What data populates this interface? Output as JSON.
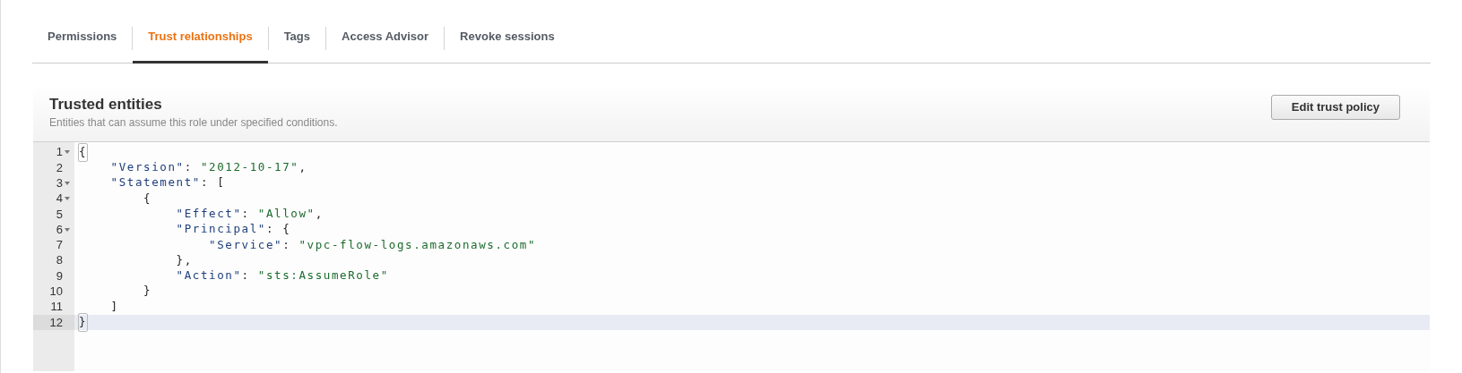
{
  "tabs": [
    {
      "label": "Permissions",
      "selected": false
    },
    {
      "label": "Trust relationships",
      "selected": true
    },
    {
      "label": "Tags",
      "selected": false
    },
    {
      "label": "Access Advisor",
      "selected": false
    },
    {
      "label": "Revoke sessions",
      "selected": false
    }
  ],
  "panel": {
    "title": "Trusted entities",
    "description": "Entities that can assume this role under specified conditions.",
    "button": "Edit trust policy"
  },
  "editor": {
    "lines": [
      {
        "number": "1",
        "foldable": true,
        "active": false,
        "tokens": [
          {
            "kind": "punct",
            "text": "{"
          }
        ]
      },
      {
        "number": "2",
        "foldable": false,
        "active": false,
        "tokens": [
          {
            "kind": "key",
            "text": "    \"Version\""
          },
          {
            "kind": "punct",
            "text": ": "
          },
          {
            "kind": "string",
            "text": "\"2012-10-17\""
          },
          {
            "kind": "punct",
            "text": ","
          }
        ]
      },
      {
        "number": "3",
        "foldable": true,
        "active": false,
        "tokens": [
          {
            "kind": "key",
            "text": "    \"Statement\""
          },
          {
            "kind": "punct",
            "text": ": ["
          }
        ]
      },
      {
        "number": "4",
        "foldable": true,
        "active": false,
        "tokens": [
          {
            "kind": "punct",
            "text": "        {"
          }
        ]
      },
      {
        "number": "5",
        "foldable": false,
        "active": false,
        "tokens": [
          {
            "kind": "key",
            "text": "            \"Effect\""
          },
          {
            "kind": "punct",
            "text": ": "
          },
          {
            "kind": "string",
            "text": "\"Allow\""
          },
          {
            "kind": "punct",
            "text": ","
          }
        ]
      },
      {
        "number": "6",
        "foldable": true,
        "active": false,
        "tokens": [
          {
            "kind": "key",
            "text": "            \"Principal\""
          },
          {
            "kind": "punct",
            "text": ": {"
          }
        ]
      },
      {
        "number": "7",
        "foldable": false,
        "active": false,
        "tokens": [
          {
            "kind": "key",
            "text": "                \"Service\""
          },
          {
            "kind": "punct",
            "text": ": "
          },
          {
            "kind": "string",
            "text": "\"vpc-flow-logs.amazonaws.com\""
          }
        ]
      },
      {
        "number": "8",
        "foldable": false,
        "active": false,
        "tokens": [
          {
            "kind": "punct",
            "text": "            },"
          }
        ]
      },
      {
        "number": "9",
        "foldable": false,
        "active": false,
        "tokens": [
          {
            "kind": "key",
            "text": "            \"Action\""
          },
          {
            "kind": "punct",
            "text": ": "
          },
          {
            "kind": "string",
            "text": "\"sts:AssumeRole\""
          }
        ]
      },
      {
        "number": "10",
        "foldable": false,
        "active": false,
        "tokens": [
          {
            "kind": "punct",
            "text": "        }"
          }
        ]
      },
      {
        "number": "11",
        "foldable": false,
        "active": false,
        "tokens": [
          {
            "kind": "punct",
            "text": "    ]"
          }
        ]
      },
      {
        "number": "12",
        "foldable": false,
        "active": true,
        "tokens": [
          {
            "kind": "punct",
            "text": "}"
          }
        ]
      }
    ]
  }
}
